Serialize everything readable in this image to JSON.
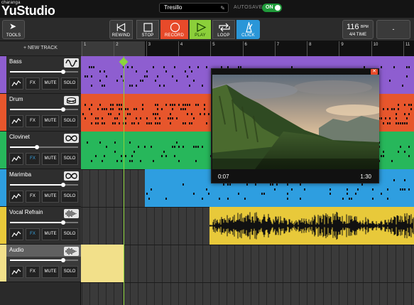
{
  "header": {
    "brand_small": "charanga",
    "brand": "YuStudio",
    "project_title": "Tresillo",
    "autosave_label": "AUTOSAVE",
    "autosave_toggle": "ON"
  },
  "toolbar": {
    "tools_label": "TOOLS",
    "rewind_label": "REWIND",
    "stop_label": "STOP",
    "record_label": "RECORD",
    "play_label": "PLAY",
    "loop_label": "LOOP",
    "click_label": "CLICK",
    "tempo_value": "116",
    "tempo_unit": "BPM",
    "time_signature": "4/4 TIME",
    "key_value": "-",
    "colors": {
      "record": "#e74a2a",
      "play": "#8bcf3a",
      "click": "#2a96d8"
    }
  },
  "tracklist": {
    "new_track_label": "+ NEW TRACK",
    "button_labels": {
      "fx": "FX",
      "mute": "MUTE",
      "solo": "SOLO"
    },
    "tracks": [
      {
        "name": "Bass",
        "color": "#8e5ed0",
        "icon": "waveform-synth-icon",
        "volume": 0.78,
        "fx_active": false
      },
      {
        "name": "Drum",
        "color": "#e7562c",
        "icon": "drum-icon",
        "volume": 0.78,
        "fx_active": false
      },
      {
        "name": "Clovinet",
        "color": "#27b75b",
        "icon": "loop-icon",
        "volume": 0.4,
        "fx_active": true
      },
      {
        "name": "Marimba",
        "color": "#2e9ee0",
        "icon": "loop-icon",
        "volume": 0.78,
        "fx_active": false
      },
      {
        "name": "Vocal Refrain",
        "color": "#e8c93a",
        "icon": "audio-wave-icon",
        "volume": 0.78,
        "fx_active": true
      },
      {
        "name": "Audio",
        "color": "#f2e08a",
        "icon": "audio-wave-icon",
        "volume": 0.78,
        "fx_active": false
      }
    ]
  },
  "timeline": {
    "bar_numbers": [
      "1",
      "2",
      "3",
      "4",
      "5",
      "6",
      "7",
      "8",
      "9",
      "10",
      "11"
    ],
    "playhead_bar": 2.3
  },
  "video": {
    "current_time": "0:07",
    "total_time": "1:30",
    "close_label": "✕"
  }
}
